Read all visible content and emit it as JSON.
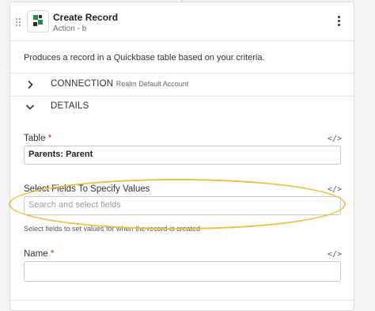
{
  "header": {
    "title": "Create Record",
    "subtitle": "Action - b"
  },
  "description": "Produces a record in a Quickbase table based on your criteria.",
  "sections": {
    "connection": {
      "label": "CONNECTION",
      "sublabel": "Realm Default Account",
      "expanded": false
    },
    "details": {
      "label": "DETAILS",
      "expanded": true
    }
  },
  "fields": {
    "table": {
      "label": "Table",
      "required_marker": "*",
      "value": "Parents: Parent",
      "code_icon": "</>"
    },
    "select_fields": {
      "label": "Select Fields To Specify Values",
      "placeholder": "Search and select fields",
      "helper": "Select fields to set values for when the record is created",
      "code_icon": "</>"
    },
    "name": {
      "label": "Name",
      "required_marker": "*",
      "value": "",
      "code_icon": "</>"
    }
  },
  "icons": {
    "drag_handle": "drag-handle-icon",
    "app": "quickbase-logo-icon",
    "menu": "more-vertical-icon",
    "chevron_right": "chevron-right-icon",
    "chevron_down": "chevron-down-icon",
    "code": "code-icon"
  },
  "colors": {
    "annotation_highlight": "#e8c14a",
    "required": "#d0202a",
    "logo_green": "#1f8a4a",
    "logo_dark": "#2b2b2b"
  }
}
